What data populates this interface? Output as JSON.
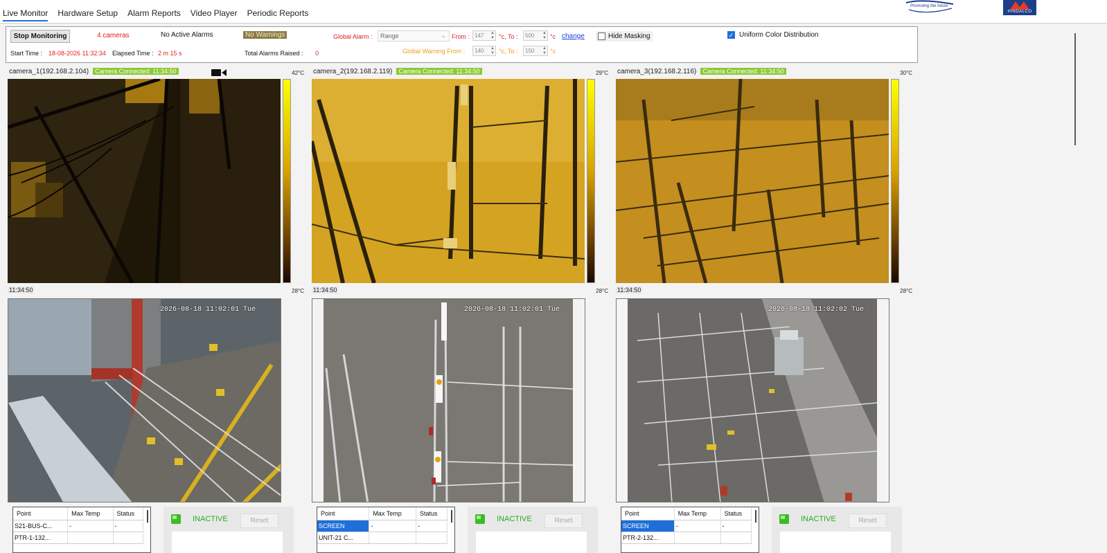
{
  "tabs": [
    "Live Monitor",
    "Hardware Setup",
    "Alarm Reports",
    "Video Player",
    "Periodic Reports"
  ],
  "logo_tagline": "Promoting the future",
  "logo2_text": "HINDALCO",
  "controls": {
    "stop_label": "Stop Monitoring",
    "cameras": "4 cameras",
    "alarms_status": "No Active Alarms",
    "warnings_status": "No Warnings",
    "start_time_label": "Start Time :",
    "start_time": "18-08-2026 11:32:34",
    "elapsed_label": "Elapsed Time :",
    "elapsed": "2 m 15 s",
    "total_alarms_label": "Total Alarms Raised :",
    "total_alarms": "0",
    "global_alarm_label": "Global Alarm :",
    "global_alarm_mode": "Range",
    "from_label": "From :",
    "alarm_from": "147",
    "to_label": "°c, To :",
    "alarm_to": "500",
    "unit": "°c",
    "change_label": "change",
    "warning_label": "Global Warning From :",
    "warn_from": "140",
    "warn_to": "150",
    "hide_masking": "Hide Masking",
    "uniform": "Uniform Color Distribution"
  },
  "cameras": [
    {
      "name": "camera_1(192.168.2.104)",
      "status": "Camera Connected: 11:34:50",
      "max": "42°C",
      "min": "28°C",
      "time": "11:34:50",
      "osd": "2026-08-18 11:02:01 Tue"
    },
    {
      "name": "camera_2(192.168.2.119)",
      "status": "Camera Connected: 11:34:50",
      "max": "29°C",
      "min": "28°C",
      "time": "11:34:50",
      "osd": "2026-08-18 11:02:01 Tue"
    },
    {
      "name": "camera_3(192.168.2.116)",
      "status": "Camera Connected: 11:34:50",
      "max": "30°C",
      "min": "28°C",
      "time": "11:34:50",
      "osd": "2026-08-18 11:02:02 Tue"
    }
  ],
  "table_headers": [
    "Point",
    "Max Temp",
    "Status"
  ],
  "tables": [
    [
      [
        "S21-BUS-C...",
        "-",
        "-"
      ],
      [
        "PTR-1-132...",
        "",
        ""
      ]
    ],
    [
      [
        "SCREEN",
        "-",
        "-"
      ],
      [
        "UNIT-21 C...",
        "",
        ""
      ]
    ],
    [
      [
        "SCREEN",
        "-",
        "-"
      ],
      [
        "PTR-2-132...",
        "",
        ""
      ]
    ]
  ],
  "panel": {
    "state": "INACTIVE",
    "reset": "Reset"
  }
}
